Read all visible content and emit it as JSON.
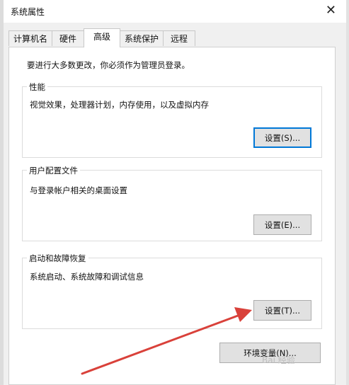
{
  "window": {
    "title": "系统属性"
  },
  "tabs": [
    {
      "label": "计算机名"
    },
    {
      "label": "硬件"
    },
    {
      "label": "高级"
    },
    {
      "label": "系统保护"
    },
    {
      "label": "远程"
    }
  ],
  "notice": "要进行大多数更改，你必须作为管理员登录。",
  "performance": {
    "title": "性能",
    "description": "视觉效果，处理器计划，内存使用，以及虚拟内存",
    "button": "设置(S)..."
  },
  "profiles": {
    "title": "用户配置文件",
    "description": "与登录帐户相关的桌面设置",
    "button": "设置(E)..."
  },
  "startup": {
    "title": "启动和故障恢复",
    "description": "系统启动、系统故障和调试信息",
    "button": "设置(T)..."
  },
  "env_button": "环境变量(N)...",
  "watermark": "Bai 经验",
  "colors": {
    "accent": "#0078d7",
    "arrow": "#d9413a"
  }
}
